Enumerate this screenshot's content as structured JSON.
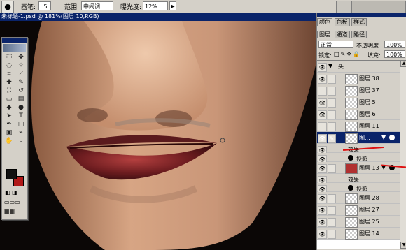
{
  "options_bar": {
    "brush_label": "画笔:",
    "brush_size": "5",
    "range_label": "范围:",
    "range_value": "中间调",
    "exposure_label": "曝光度:",
    "exposure_value": "12%"
  },
  "document": {
    "title": "未标题-1.psd @ 181%(图层 10,RGB)"
  },
  "panel": {
    "tabs": [
      "颜色",
      "色板",
      "样式"
    ],
    "layers_tabs": [
      "图层",
      "通道",
      "路径"
    ],
    "blend_mode": "正常",
    "opacity_label": "不透明度:",
    "opacity_value": "100%",
    "lock_label": "锁定:",
    "fill_label": "填充:",
    "fill_value": "100%"
  },
  "layers": [
    {
      "kind": "group",
      "name": "头",
      "visible": true
    },
    {
      "kind": "layer",
      "name": "图层 38",
      "visible": true
    },
    {
      "kind": "layer",
      "name": "图层 37",
      "visible": false
    },
    {
      "kind": "layer",
      "name": "图层 5",
      "visible": true
    },
    {
      "kind": "layer",
      "name": "图层 6",
      "visible": true
    },
    {
      "kind": "layer",
      "name": "图层 11",
      "visible": false
    },
    {
      "kind": "layer",
      "name": "图...",
      "visible": true,
      "selected": true
    },
    {
      "kind": "fx",
      "name": "效果"
    },
    {
      "kind": "fx",
      "name": "投影"
    },
    {
      "kind": "layer",
      "name": "图层 13",
      "visible": true
    },
    {
      "kind": "fx",
      "name": "效果"
    },
    {
      "kind": "fx",
      "name": "投影"
    },
    {
      "kind": "layer",
      "name": "图层 28",
      "visible": true
    },
    {
      "kind": "layer",
      "name": "图层 27",
      "visible": true
    },
    {
      "kind": "layer",
      "name": "图层 25",
      "visible": true
    },
    {
      "kind": "layer",
      "name": "图层 14",
      "visible": true
    }
  ],
  "colors": {
    "titlebar": "#0a246a",
    "foreground": "#111111",
    "background": "#b01818",
    "highlight_line": "#d11111"
  }
}
